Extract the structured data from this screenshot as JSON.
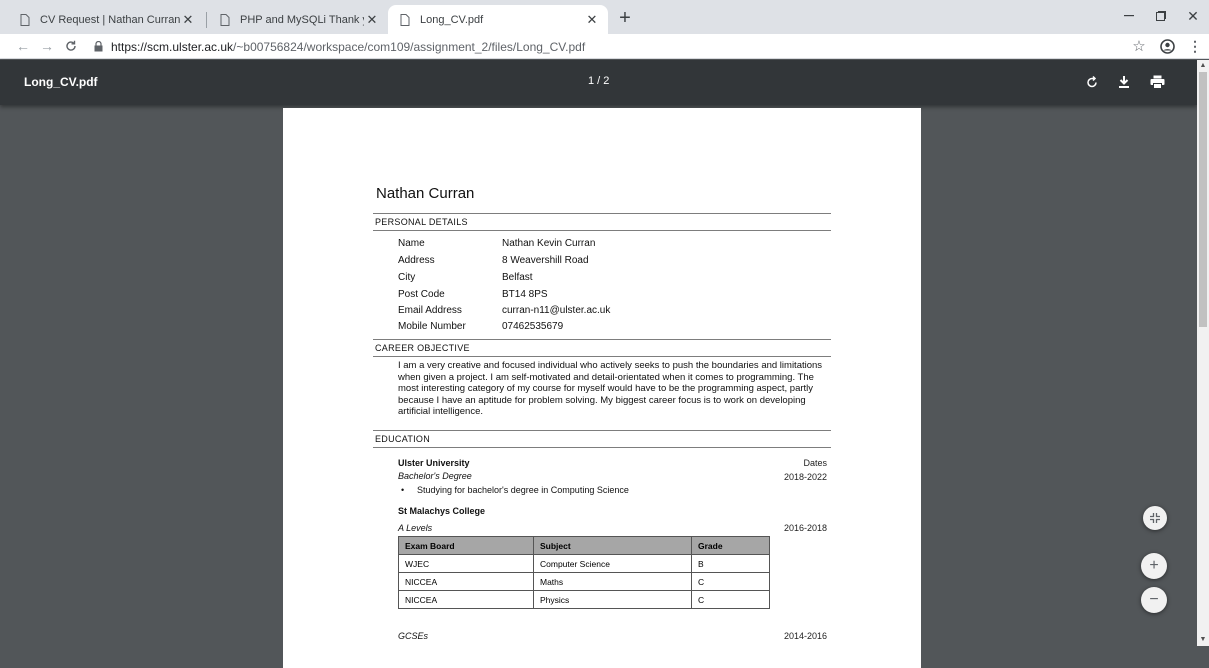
{
  "browser": {
    "tabs": [
      {
        "title": "CV Request | Nathan Curran"
      },
      {
        "title": "PHP and MySQLi Thank you mes"
      },
      {
        "title": "Long_CV.pdf"
      }
    ],
    "new_tab": "+",
    "url_host": "https://scm.ulster.ac.uk",
    "url_path": "/~b00756824/workspace/com109/assignment_2/files/Long_CV.pdf"
  },
  "viewer": {
    "file_name": "Long_CV.pdf",
    "page_indicator": "1 / 2"
  },
  "cv": {
    "name": "Nathan Curran",
    "personal_heading": "PERSONAL DETAILS",
    "personal": [
      {
        "label": "Name",
        "value": "Nathan Kevin Curran"
      },
      {
        "label": "Address",
        "value": "8 Weavershill Road"
      },
      {
        "label": "City",
        "value": "Belfast"
      },
      {
        "label": "Post Code",
        "value": "BT14 8PS"
      },
      {
        "label": "Email Address",
        "value": "curran-n11@ulster.ac.uk"
      },
      {
        "label": "Mobile Number",
        "value": "07462535679"
      }
    ],
    "objective_heading": "CAREER OBJECTIVE",
    "objective": "I am a very creative and focused individual who actively seeks to push the boundaries and limitations when given a project. I am self-motivated and detail-orientated when it comes to programming. The most interesting category of my course for myself would have to be the programming aspect, partly because I have an aptitude for problem solving. My biggest career focus is to work on developing artificial intelligence.",
    "education_heading": "EDUCATION",
    "dates_label": "Dates",
    "uni": {
      "name": "Ulster University",
      "degree": "Bachelor's Degree",
      "dates": "2018-2022",
      "bullet": "Studying for bachelor's degree in Computing Science"
    },
    "college": {
      "name": "St Malachys College",
      "alevels": "A Levels",
      "alevels_dates": "2016-2018",
      "table_headers": [
        "Exam Board",
        "Subject",
        "Grade"
      ],
      "rows": [
        [
          "WJEC",
          "Computer Science",
          "B"
        ],
        [
          "NICCEA",
          "Maths",
          "C"
        ],
        [
          "NICCEA",
          "Physics",
          "C"
        ]
      ],
      "gcses": "GCSEs",
      "gcses_dates": "2014-2016"
    }
  }
}
